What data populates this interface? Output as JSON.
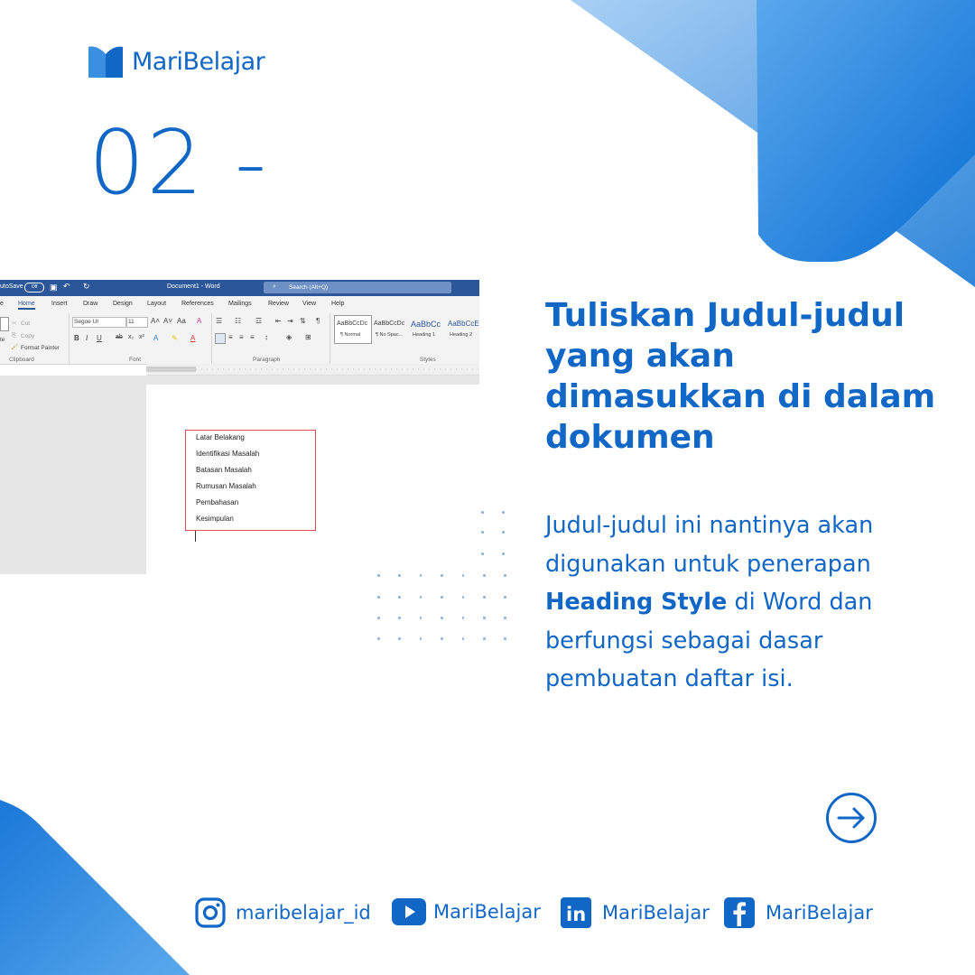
{
  "brand": {
    "name": "MariBelajar"
  },
  "colors": {
    "primary": "#1167c6",
    "light": "#8fc1ef"
  },
  "step": "02 -",
  "word_ui": {
    "title_left": "utoSave",
    "toggle": "Off",
    "doc_title": "Document1  -  Word",
    "search_placeholder": "Search (Alt+Q)",
    "tabs": [
      "e",
      "Home",
      "Insert",
      "Draw",
      "Design",
      "Layout",
      "References",
      "Mailings",
      "Review",
      "View",
      "Help"
    ],
    "clipboard": {
      "cut": "Cut",
      "copy": "Copy",
      "format_painter": "Format Painter",
      "paste": "te",
      "label": "Clipboard"
    },
    "font": {
      "name": "Segoe UI",
      "size": "11",
      "label": "Font"
    },
    "paragraph_label": "Paragraph",
    "styles": [
      {
        "preview": "AaBbCcDc",
        "name": "¶ Normal"
      },
      {
        "preview": "AaBbCcDc",
        "name": "¶ No Spac..."
      },
      {
        "preview": "AaBbCc",
        "name": "Heading 1"
      },
      {
        "preview": "AaBbCcE",
        "name": "Heading 2"
      }
    ],
    "styles_label": "Styles",
    "doc_lines": [
      "Latar Belakang",
      "Identifikasi Masalah",
      "Batasan Masalah",
      "Rumusan Masalah",
      "Pembahasan",
      "Kesimpulan"
    ]
  },
  "heading": "Tuliskan Judul-judul yang akan dimasukkan di dalam dokumen",
  "body": {
    "part1": "Judul-judul ini nantinya akan digunakan untuk penerapan ",
    "bold": "Heading Style",
    "part2": " di Word dan berfungsi sebagai dasar pembuatan daftar isi."
  },
  "next_icon": "arrow-right-circle-icon",
  "social": [
    {
      "icon": "instagram-icon",
      "handle": "maribelajar_id"
    },
    {
      "icon": "youtube-icon",
      "handle": "MariBelajar"
    },
    {
      "icon": "linkedin-icon",
      "handle": "MariBelajar"
    },
    {
      "icon": "facebook-icon",
      "handle": "MariBelajar"
    }
  ]
}
